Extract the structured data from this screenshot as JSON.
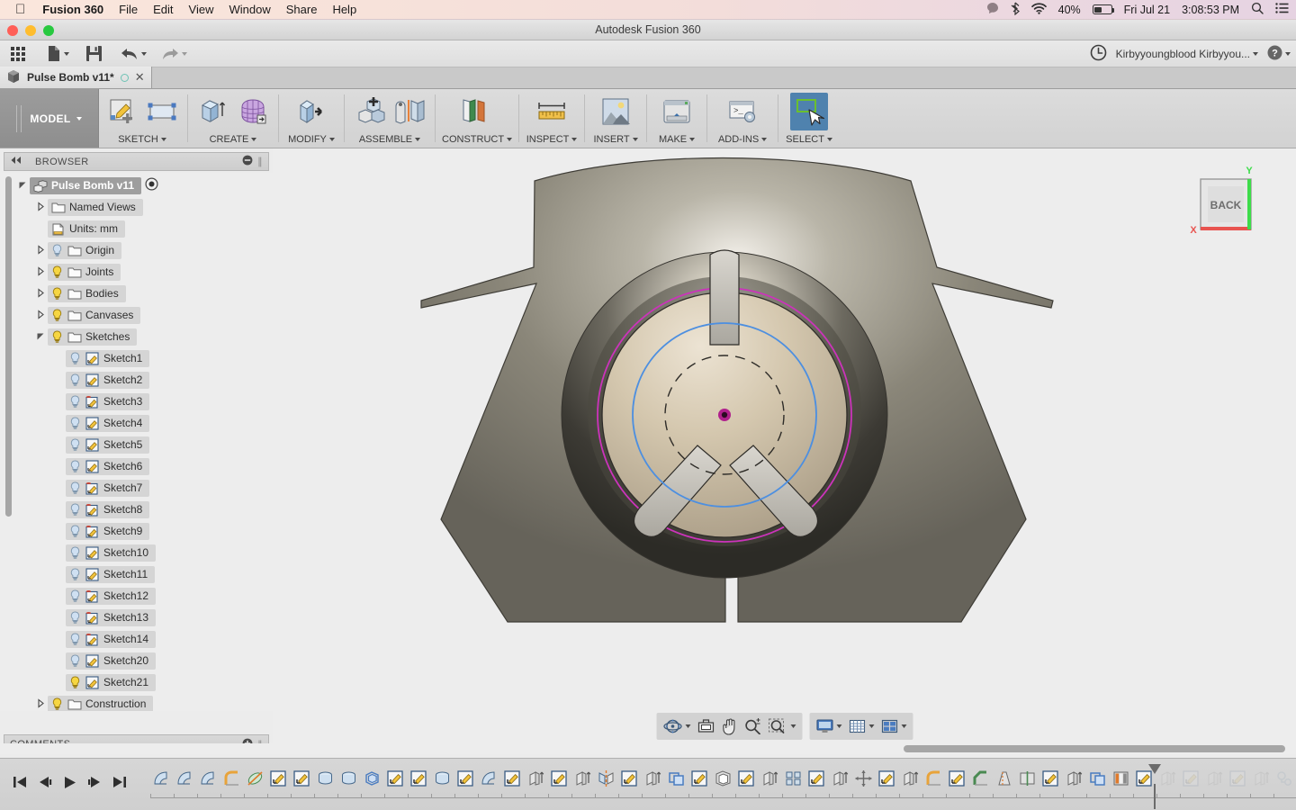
{
  "macbar": {
    "apple_icon": "apple-icon",
    "app_name": "Fusion 360",
    "menus": [
      "File",
      "Edit",
      "View",
      "Window",
      "Share",
      "Help"
    ],
    "status": {
      "notification_icon": "notification-icon",
      "bluetooth_icon": "bluetooth-icon",
      "wifi_icon": "wifi-icon",
      "battery_percent": "40%",
      "battery_icon": "battery-icon",
      "date": "Fri Jul 21",
      "time": "3:08:53 PM",
      "search_icon": "search-icon",
      "list_icon": "notification-center-icon"
    }
  },
  "window": {
    "title": "Autodesk Fusion 360",
    "close_color": "#ff5f57",
    "minimize_color": "#ffbd2e",
    "zoom_color": "#28c940"
  },
  "qat": {
    "items": [
      {
        "name": "app-grid-icon",
        "label": "Show Data Panel",
        "caret": false
      },
      {
        "name": "new-file-icon",
        "label": "File",
        "caret": true
      },
      {
        "name": "save-icon",
        "label": "Save",
        "caret": false
      },
      {
        "name": "undo-icon",
        "label": "Undo",
        "caret": true
      },
      {
        "name": "redo-icon",
        "label": "Redo",
        "caret": true
      }
    ],
    "right": {
      "history_icon": "clock-icon",
      "account_label": "Kirbyyoungblood Kirbyyou...",
      "help_icon": "help-icon"
    }
  },
  "tab": {
    "label": "Pulse Bomb v11*",
    "cube_icon": "document-cube-icon",
    "status_icon": "sync-circle-icon",
    "close_icon": "close-icon"
  },
  "ribbon": {
    "workspace": "MODEL",
    "panels": [
      {
        "label": "SKETCH",
        "tools": [
          "create-sketch-icon",
          "rectangle-icon"
        ],
        "active": false
      },
      {
        "label": "CREATE",
        "tools": [
          "extrude-icon",
          "form-icon"
        ],
        "active": false
      },
      {
        "label": "MODIFY",
        "tools": [
          "press-pull-icon"
        ],
        "active": false
      },
      {
        "label": "ASSEMBLE",
        "tools": [
          "new-component-icon",
          "joint-icon"
        ],
        "active": false
      },
      {
        "label": "CONSTRUCT",
        "tools": [
          "offset-plane-icon"
        ],
        "active": false
      },
      {
        "label": "INSPECT",
        "tools": [
          "measure-icon"
        ],
        "active": false
      },
      {
        "label": "INSERT",
        "tools": [
          "insert-image-icon"
        ],
        "active": false
      },
      {
        "label": "MAKE",
        "tools": [
          "3d-print-icon"
        ],
        "active": false
      },
      {
        "label": "ADD-INS",
        "tools": [
          "script-icon"
        ],
        "active": false
      },
      {
        "label": "SELECT",
        "tools": [
          "select-cursor-icon"
        ],
        "active": true
      }
    ]
  },
  "browser": {
    "title": "BROWSER",
    "collapse_icon": "collapse-left-icon",
    "minimize_icon": "minimize-icon",
    "tree": [
      {
        "label": "Pulse Bomb v11",
        "depth": 0,
        "arrow": "expanded",
        "bulb": "none",
        "icon": "component-icon",
        "selected": true,
        "radio": true
      },
      {
        "label": "Named Views",
        "depth": 1,
        "arrow": "collapsed",
        "bulb": "none",
        "icon": "folder-icon",
        "selected": false
      },
      {
        "label": "Units: mm",
        "depth": 1,
        "arrow": "none",
        "bulb": "none",
        "icon": "units-icon",
        "selected": false
      },
      {
        "label": "Origin",
        "depth": 1,
        "arrow": "collapsed",
        "bulb": "off",
        "icon": "folder-icon",
        "selected": false
      },
      {
        "label": "Joints",
        "depth": 1,
        "arrow": "collapsed",
        "bulb": "on",
        "icon": "folder-icon",
        "selected": false
      },
      {
        "label": "Bodies",
        "depth": 1,
        "arrow": "collapsed",
        "bulb": "on",
        "icon": "folder-icon",
        "selected": false
      },
      {
        "label": "Canvases",
        "depth": 1,
        "arrow": "collapsed",
        "bulb": "on",
        "icon": "folder-icon",
        "selected": false
      },
      {
        "label": "Sketches",
        "depth": 1,
        "arrow": "expanded",
        "bulb": "on",
        "icon": "folder-icon",
        "selected": false
      },
      {
        "label": "Sketch1",
        "depth": 2,
        "arrow": "none",
        "bulb": "off",
        "icon": "sketch-icon",
        "selected": false
      },
      {
        "label": "Sketch2",
        "depth": 2,
        "arrow": "none",
        "bulb": "off",
        "icon": "sketch-icon",
        "selected": false
      },
      {
        "label": "Sketch3",
        "depth": 2,
        "arrow": "none",
        "bulb": "off",
        "icon": "sketch-warning-icon",
        "selected": false
      },
      {
        "label": "Sketch4",
        "depth": 2,
        "arrow": "none",
        "bulb": "off",
        "icon": "sketch-icon",
        "selected": false
      },
      {
        "label": "Sketch5",
        "depth": 2,
        "arrow": "none",
        "bulb": "off",
        "icon": "sketch-icon",
        "selected": false
      },
      {
        "label": "Sketch6",
        "depth": 2,
        "arrow": "none",
        "bulb": "off",
        "icon": "sketch-icon",
        "selected": false
      },
      {
        "label": "Sketch7",
        "depth": 2,
        "arrow": "none",
        "bulb": "off",
        "icon": "sketch-warning-icon",
        "selected": false
      },
      {
        "label": "Sketch8",
        "depth": 2,
        "arrow": "none",
        "bulb": "off",
        "icon": "sketch-warning-icon",
        "selected": false
      },
      {
        "label": "Sketch9",
        "depth": 2,
        "arrow": "none",
        "bulb": "off",
        "icon": "sketch-warning-icon",
        "selected": false
      },
      {
        "label": "Sketch10",
        "depth": 2,
        "arrow": "none",
        "bulb": "off",
        "icon": "sketch-icon",
        "selected": false
      },
      {
        "label": "Sketch11",
        "depth": 2,
        "arrow": "none",
        "bulb": "off",
        "icon": "sketch-icon",
        "selected": false
      },
      {
        "label": "Sketch12",
        "depth": 2,
        "arrow": "none",
        "bulb": "off",
        "icon": "sketch-warning-icon",
        "selected": false
      },
      {
        "label": "Sketch13",
        "depth": 2,
        "arrow": "none",
        "bulb": "off",
        "icon": "sketch-warning-icon",
        "selected": false
      },
      {
        "label": "Sketch14",
        "depth": 2,
        "arrow": "none",
        "bulb": "off",
        "icon": "sketch-warning-icon",
        "selected": false
      },
      {
        "label": "Sketch20",
        "depth": 2,
        "arrow": "none",
        "bulb": "off",
        "icon": "sketch-icon",
        "selected": false
      },
      {
        "label": "Sketch21",
        "depth": 2,
        "arrow": "none",
        "bulb": "on",
        "icon": "sketch-icon",
        "selected": false
      },
      {
        "label": "Construction",
        "depth": 1,
        "arrow": "collapsed",
        "bulb": "on",
        "icon": "folder-icon",
        "selected": false
      }
    ]
  },
  "comments": {
    "title": "COMMENTS",
    "add_icon": "add-comment-icon"
  },
  "viewcube": {
    "face_label": "BACK",
    "axis_x_label": "X",
    "axis_y_label": "Y",
    "axis_x_color": "#e8534f",
    "axis_y_color": "#3ddc4a"
  },
  "navbar": {
    "group1": [
      {
        "name": "orbit-icon",
        "caret": true
      },
      {
        "name": "look-at-icon",
        "caret": false
      },
      {
        "name": "pan-icon",
        "caret": false
      },
      {
        "name": "zoom-icon",
        "caret": false
      },
      {
        "name": "fit-icon",
        "caret": true
      }
    ],
    "group2": [
      {
        "name": "display-settings-icon",
        "caret": true
      },
      {
        "name": "grid-snap-icon",
        "caret": true
      },
      {
        "name": "viewports-icon",
        "caret": true
      }
    ]
  },
  "timeline": {
    "playback": [
      {
        "name": "go-to-beginning-icon"
      },
      {
        "name": "step-back-icon"
      },
      {
        "name": "play-icon"
      },
      {
        "name": "step-forward-icon"
      },
      {
        "name": "go-to-end-icon"
      }
    ],
    "features": [
      {
        "name": "revolve-icon",
        "state": "active"
      },
      {
        "name": "revolve-icon",
        "state": "active"
      },
      {
        "name": "revolve-icon",
        "state": "active"
      },
      {
        "name": "fillet-icon",
        "state": "active"
      },
      {
        "name": "pipe-icon",
        "state": "active"
      },
      {
        "name": "sketch-icon",
        "state": "active"
      },
      {
        "name": "sketch-icon",
        "state": "active"
      },
      {
        "name": "loft-icon",
        "state": "active"
      },
      {
        "name": "loft-icon",
        "state": "active"
      },
      {
        "name": "offset-face-icon",
        "state": "active"
      },
      {
        "name": "sketch-icon",
        "state": "active"
      },
      {
        "name": "sketch-icon",
        "state": "active"
      },
      {
        "name": "loft-icon",
        "state": "active"
      },
      {
        "name": "sketch-icon",
        "state": "active"
      },
      {
        "name": "revolve-icon",
        "state": "active"
      },
      {
        "name": "sketch-icon",
        "state": "active"
      },
      {
        "name": "extrude-icon",
        "state": "active"
      },
      {
        "name": "sketch-icon",
        "state": "active"
      },
      {
        "name": "extrude-icon",
        "state": "active"
      },
      {
        "name": "mirror-icon",
        "state": "active"
      },
      {
        "name": "sketch-icon",
        "state": "active"
      },
      {
        "name": "extrude-icon",
        "state": "active"
      },
      {
        "name": "combine-icon",
        "state": "active"
      },
      {
        "name": "sketch-icon",
        "state": "active"
      },
      {
        "name": "shell-icon",
        "state": "active"
      },
      {
        "name": "sketch-icon",
        "state": "active"
      },
      {
        "name": "extrude-icon",
        "state": "active"
      },
      {
        "name": "pattern-icon",
        "state": "active"
      },
      {
        "name": "sketch-icon",
        "state": "active"
      },
      {
        "name": "extrude-icon",
        "state": "active"
      },
      {
        "name": "move-icon",
        "state": "active"
      },
      {
        "name": "sketch-icon",
        "state": "active"
      },
      {
        "name": "extrude-icon",
        "state": "active"
      },
      {
        "name": "fillet-icon",
        "state": "active"
      },
      {
        "name": "sketch-icon",
        "state": "active"
      },
      {
        "name": "chamfer-icon",
        "state": "active"
      },
      {
        "name": "draft-icon",
        "state": "active"
      },
      {
        "name": "split-face-icon",
        "state": "active"
      },
      {
        "name": "sketch-icon",
        "state": "active"
      },
      {
        "name": "extrude-icon",
        "state": "active"
      },
      {
        "name": "combine-icon",
        "state": "active"
      },
      {
        "name": "appearance-icon",
        "state": "active"
      },
      {
        "name": "sketch-icon",
        "state": "marker"
      },
      {
        "name": "extrude-icon",
        "state": "rolled"
      },
      {
        "name": "sketch-icon",
        "state": "rolled"
      },
      {
        "name": "extrude-icon",
        "state": "rolled"
      },
      {
        "name": "sketch-icon",
        "state": "rolled"
      },
      {
        "name": "extrude-icon",
        "state": "rolled"
      },
      {
        "name": "joint-icon",
        "state": "rolled"
      },
      {
        "name": "move-icon",
        "state": "rolled"
      },
      {
        "name": "align-icon",
        "state": "rolled"
      },
      {
        "name": "move-icon",
        "state": "rolled"
      }
    ],
    "settings_icon": "gear-icon"
  },
  "model": {
    "shell_color": "#8a8677",
    "face_color": "#cdbfa8",
    "sketch_circle_color": "#cc33bb",
    "construction_circle_color": "#4d8fe0",
    "origin_point_color": "#b0208c"
  }
}
